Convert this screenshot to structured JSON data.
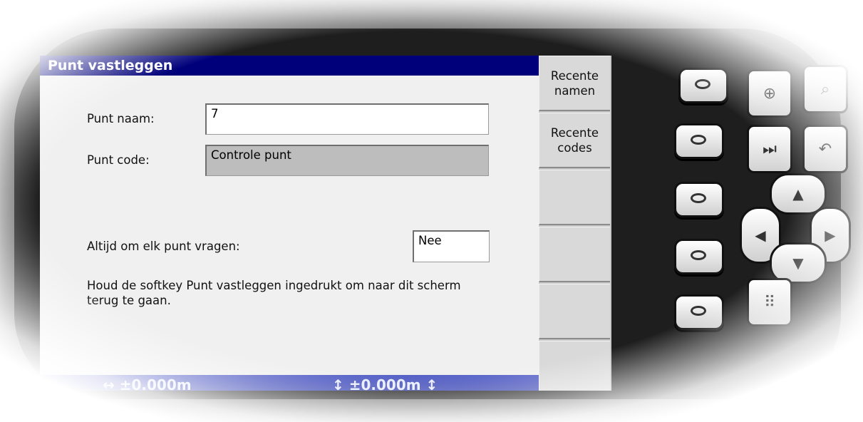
{
  "window": {
    "title": "Punt vastleggen"
  },
  "form": {
    "point_name_label": "Punt naam:",
    "point_name_value": "7",
    "point_code_label": "Punt code:",
    "point_code_value": "Controle punt",
    "always_ask_label": "Altijd om elk punt vragen:",
    "always_ask_value": "Nee",
    "help_text": "Houd de softkey Punt vastleggen ingedrukt om naar dit scherm terug te gaan."
  },
  "softkeys": {
    "recent_names": "Recente\nnamen",
    "recent_codes": "Recente\ncodes"
  },
  "statusbar": {
    "left_value": "↔ ±0.000m",
    "right_value": "↕ ±0.000m ↕"
  },
  "icons": {
    "zoom_in": "zoom-in-icon",
    "zoom_out": "zoom-out-icon",
    "next": "skip-next-icon",
    "undo": "undo-icon",
    "keypad": "keypad-icon"
  }
}
